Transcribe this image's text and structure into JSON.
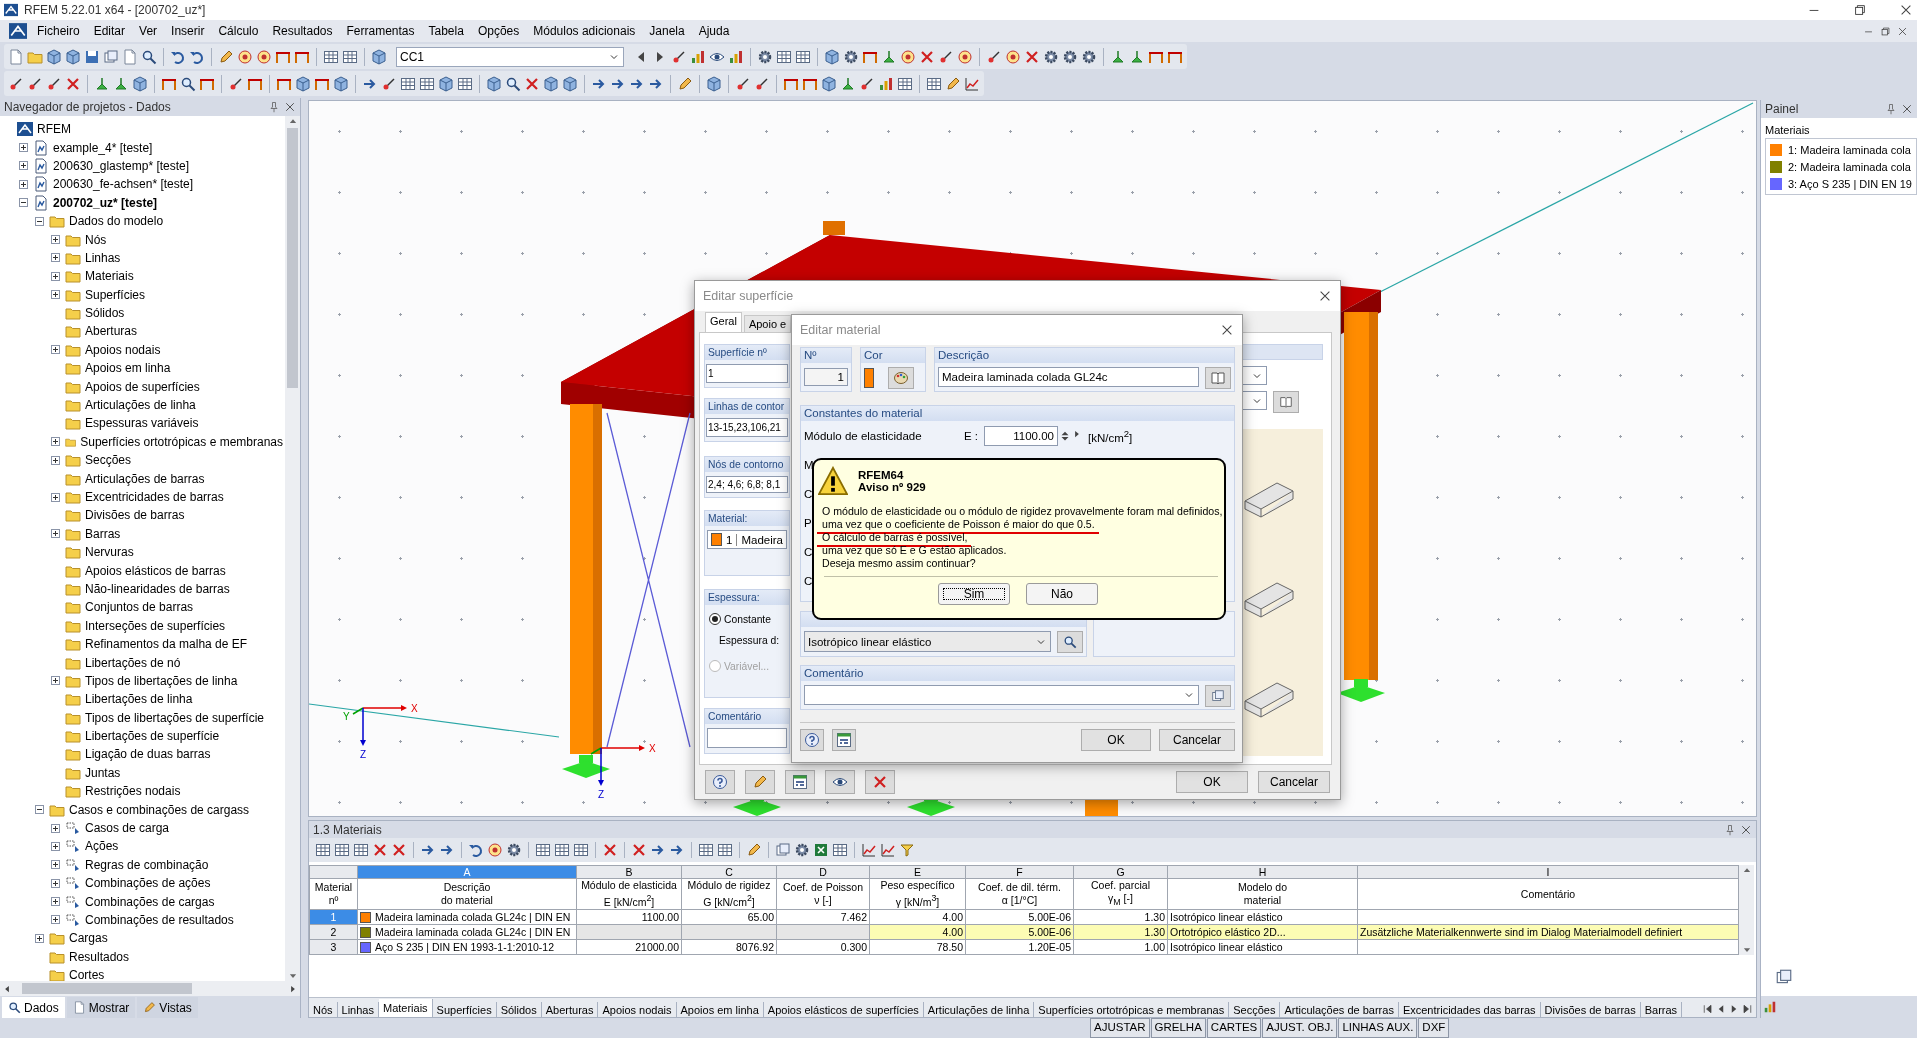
{
  "window": {
    "title": "RFEM 5.22.01 x64 - [200702_uz*]"
  },
  "menu": [
    "Ficheiro",
    "Editar",
    "Ver",
    "Inserir",
    "Cálculo",
    "Resultados",
    "Ferramentas",
    "Tabela",
    "Opções",
    "Módulos adicionais",
    "Janela",
    "Ajuda"
  ],
  "toolbar": {
    "load_case": "CC1"
  },
  "navigator": {
    "title": "Navegador de projetos - Dados",
    "tree": [
      {
        "label": "RFEM",
        "kind": "app",
        "children": [
          {
            "label": "example_4* [teste]",
            "kind": "project",
            "expanded": false,
            "active": false
          },
          {
            "label": "200630_glastemp* [teste]",
            "kind": "project",
            "expanded": false,
            "active": false
          },
          {
            "label": "200630_fe-achsen* [teste]",
            "kind": "project",
            "expanded": false,
            "active": false
          },
          {
            "label": "200702_uz* [teste]",
            "kind": "project",
            "expanded": true,
            "active": true,
            "children": [
              {
                "label": "Dados do modelo",
                "kind": "folder",
                "expanded": true,
                "children": [
                  {
                    "label": "Nós",
                    "kind": "folder",
                    "expanded": false
                  },
                  {
                    "label": "Linhas",
                    "kind": "folder",
                    "expanded": false
                  },
                  {
                    "label": "Materiais",
                    "kind": "folder",
                    "expanded": false
                  },
                  {
                    "label": "Superfícies",
                    "kind": "folder",
                    "expanded": false
                  },
                  {
                    "label": "Sólidos",
                    "kind": "folder"
                  },
                  {
                    "label": "Aberturas",
                    "kind": "folder"
                  },
                  {
                    "label": "Apoios nodais",
                    "kind": "folder",
                    "expanded": false
                  },
                  {
                    "label": "Apoios em linha",
                    "kind": "folder"
                  },
                  {
                    "label": "Apoios de superfícies",
                    "kind": "folder"
                  },
                  {
                    "label": "Articulações de linha",
                    "kind": "folder"
                  },
                  {
                    "label": "Espessuras variáveis",
                    "kind": "folder"
                  },
                  {
                    "label": "Superfícies ortotrópicas e membranas",
                    "kind": "folder",
                    "expanded": false
                  },
                  {
                    "label": "Secções",
                    "kind": "folder",
                    "expanded": false
                  },
                  {
                    "label": "Articulações de barras",
                    "kind": "folder"
                  },
                  {
                    "label": "Excentricidades de barras",
                    "kind": "folder",
                    "expanded": false
                  },
                  {
                    "label": "Divisões de barras",
                    "kind": "folder"
                  },
                  {
                    "label": "Barras",
                    "kind": "folder",
                    "expanded": false
                  },
                  {
                    "label": "Nervuras",
                    "kind": "folder"
                  },
                  {
                    "label": "Apoios elásticos de barras",
                    "kind": "folder"
                  },
                  {
                    "label": "Não-linearidades de barras",
                    "kind": "folder"
                  },
                  {
                    "label": "Conjuntos de barras",
                    "kind": "folder"
                  },
                  {
                    "label": "Interseções de superfícies",
                    "kind": "folder"
                  },
                  {
                    "label": "Refinamentos da malha de EF",
                    "kind": "folder"
                  },
                  {
                    "label": "Libertações de nó",
                    "kind": "folder"
                  },
                  {
                    "label": "Tipos de libertações de linha",
                    "kind": "folder",
                    "expanded": false
                  },
                  {
                    "label": "Libertações de linha",
                    "kind": "folder"
                  },
                  {
                    "label": "Tipos de libertações de superfície",
                    "kind": "folder"
                  },
                  {
                    "label": "Libertações de superfície",
                    "kind": "folder"
                  },
                  {
                    "label": "Ligação de duas barras",
                    "kind": "folder"
                  },
                  {
                    "label": "Juntas",
                    "kind": "folder"
                  },
                  {
                    "label": "Restrições nodais",
                    "kind": "folder"
                  }
                ]
              },
              {
                "label": "Casos e combinações de cargass",
                "kind": "folder",
                "expanded": true,
                "children": [
                  {
                    "label": "Casos de carga",
                    "kind": "case",
                    "expanded": false
                  },
                  {
                    "label": "Ações",
                    "kind": "case",
                    "expanded": false
                  },
                  {
                    "label": "Regras de combinação",
                    "kind": "case",
                    "expanded": false
                  },
                  {
                    "label": "Combinações de ações",
                    "kind": "case",
                    "expanded": false
                  },
                  {
                    "label": "Combinações de cargas",
                    "kind": "case",
                    "expanded": false
                  },
                  {
                    "label": "Combinações de resultados",
                    "kind": "case",
                    "expanded": false
                  }
                ]
              },
              {
                "label": "Cargas",
                "kind": "folder",
                "expanded": false
              },
              {
                "label": "Resultados",
                "kind": "folder"
              },
              {
                "label": "Cortes",
                "kind": "folder"
              }
            ]
          }
        ]
      }
    ],
    "tabs": [
      {
        "label": "Dados",
        "selected": true
      },
      {
        "label": "Mostrar",
        "selected": false
      },
      {
        "label": "Vistas",
        "selected": false
      }
    ]
  },
  "view": {
    "axes": [
      {
        "x": "X",
        "y": "Y",
        "z": "Z"
      },
      {
        "x": "X",
        "z": "Z"
      }
    ]
  },
  "surface_dialog": {
    "title": "Editar superfície",
    "tabs": [
      {
        "label": "Geral",
        "selected": true
      },
      {
        "label": "Apoio e",
        "selected": false
      }
    ],
    "surface_no": {
      "label": "Superfície nº",
      "value": "1"
    },
    "boundary_lines": {
      "label": "Linhas de contor",
      "value": "13-15,23,106,21"
    },
    "boundary_nodes": {
      "label": "Nós de contorno",
      "value": "2,4; 4,6; 6,8; 8,1"
    },
    "material": {
      "label": "Material:",
      "color": "#ff8000",
      "number": "1",
      "name": "Madeira"
    },
    "thickness": {
      "label": "Espessura:",
      "field_label": "Espessura d:",
      "options": [
        {
          "label": "Constante",
          "selected": true,
          "disabled": false
        },
        {
          "label": "Variável...",
          "selected": false,
          "disabled": true
        }
      ]
    },
    "comment": {
      "label": "Comentário"
    },
    "buttons": [
      "OK",
      "Cancelar"
    ]
  },
  "material_dialog": {
    "title": "Editar material",
    "number": {
      "label": "Nº",
      "value": "1"
    },
    "swatch": {
      "label": "Cor",
      "color": "#ff8000"
    },
    "description": {
      "label": "Descrição",
      "value": "Madeira laminada colada GL24c"
    },
    "constants": {
      "label": "Constantes do material",
      "elasticity": {
        "label": "Módulo de elasticidade",
        "symbol": "E :",
        "value": "1100.00",
        "unit": "[kN/cm$^{2}$]"
      },
      "covered_labels": [
        "M",
        "C",
        "P",
        "C",
        "C"
      ]
    },
    "material_model": {
      "value": "Isotrópico linear elástico"
    },
    "comment": {
      "label": "Comentário"
    },
    "buttons": [
      "OK",
      "Cancelar"
    ]
  },
  "warning": {
    "app": "RFEM64",
    "title": "Aviso nº 929",
    "lines": [
      {
        "text": "O módulo de elasticidade ou o módulo de rigidez provavelmente foram mal definidos,",
        "underlined": false
      },
      {
        "text": "uma vez que o coeficiente de Poisson é maior do que 0.5.",
        "underlined": true
      },
      {
        "text": "O cálculo de barras é possível,",
        "underlined": true
      },
      {
        "text": "uma vez que só E e G estão aplicados.",
        "underlined": false
      },
      {
        "text": "Deseja mesmo assim continuar?",
        "underlined": false
      }
    ],
    "buttons": [
      {
        "label": "Sim",
        "selected": true
      },
      {
        "label": "Não",
        "selected": false
      }
    ]
  },
  "panel": {
    "title": "Painel",
    "heading": "Materiais",
    "items": [
      {
        "label": "1: Madeira laminada cola",
        "color": "#ff8000"
      },
      {
        "label": "2: Madeira laminada cola",
        "color": "#808000"
      },
      {
        "label": "3: Aço S 235 | DIN EN 19",
        "color": "#6666ff"
      }
    ]
  },
  "table": {
    "title": "1.3 Materiais",
    "columns": [
      {
        "header": [
          "Material",
          "nº"
        ]
      },
      {
        "letter": "A",
        "selected": true,
        "header": [
          "Descrição",
          "do material"
        ]
      },
      {
        "letter": "B",
        "selected": false,
        "header": [
          "Módulo de elasticida",
          "E [kN/cm$^{2}$]"
        ]
      },
      {
        "letter": "C",
        "selected": false,
        "header": [
          "Módulo de rigidez",
          "G [kN/cm$^{2}$]"
        ]
      },
      {
        "letter": "D",
        "selected": false,
        "header": [
          "Coef. de Poisson",
          "ν [-]"
        ]
      },
      {
        "letter": "E",
        "selected": false,
        "header": [
          "Peso específico",
          "γ [kN/m$^{3}$]"
        ]
      },
      {
        "letter": "F",
        "selected": false,
        "header": [
          "Coef. de dil. térm.",
          "α [1/°C]"
        ]
      },
      {
        "letter": "G",
        "selected": false,
        "header": [
          "Coef. parcial",
          "γ$_{M}$ [-]"
        ]
      },
      {
        "letter": "H",
        "selected": false,
        "header": [
          "Modelo do",
          "material"
        ]
      },
      {
        "letter": "I",
        "selected": false,
        "header": [
          "Comentário"
        ]
      }
    ],
    "rows": [
      {
        "selected": true,
        "highlighted": false,
        "color": "#ff8000",
        "cells": [
          "1",
          "Madeira laminada colada GL24c | DIN EN",
          "1100.00",
          "65.00",
          "7.462",
          "4.00",
          "5.00E-06",
          "1.30",
          "Isotrópico linear elástico",
          ""
        ]
      },
      {
        "selected": false,
        "highlighted": true,
        "color": "#808000",
        "cells": [
          "2",
          "Madeira laminada colada GL24c | DIN EN",
          "",
          "",
          "",
          "4.00",
          "5.00E-06",
          "1.30",
          "Ortotrópico elástico 2D...",
          "Zusätzliche Materialkennwerte sind im Dialog Materialmodell definiert"
        ]
      },
      {
        "selected": false,
        "highlighted": false,
        "color": "#6666ff",
        "cells": [
          "3",
          "Aço S 235 | DIN EN 1993-1-1:2010-12",
          "21000.00",
          "8076.92",
          "0.300",
          "78.50",
          "1.20E-05",
          "1.00",
          "Isotrópico linear elástico",
          ""
        ]
      }
    ],
    "tabs": [
      {
        "label": "Nós",
        "selected": false
      },
      {
        "label": "Linhas",
        "selected": false
      },
      {
        "label": "Materiais",
        "selected": true
      },
      {
        "label": "Superfícies",
        "selected": false
      },
      {
        "label": "Sólidos",
        "selected": false
      },
      {
        "label": "Aberturas",
        "selected": false
      },
      {
        "label": "Apoios nodais",
        "selected": false
      },
      {
        "label": "Apoios em linha",
        "selected": false
      },
      {
        "label": "Apoios elásticos de superfícies",
        "selected": false
      },
      {
        "label": "Articulações de linha",
        "selected": false
      },
      {
        "label": "Superfícies ortotrópicas e membranas",
        "selected": false
      },
      {
        "label": "Secções",
        "selected": false
      },
      {
        "label": "Articulações de barras",
        "selected": false
      },
      {
        "label": "Excentricidades das barras",
        "selected": false
      },
      {
        "label": "Divisões de barras",
        "selected": false
      },
      {
        "label": "Barras",
        "selected": false
      }
    ]
  },
  "status_bar": [
    "AJUSTAR",
    "GRELHA",
    "CARTES",
    "AJUST. OBJ.",
    "LINHAS AUX.",
    "DXF"
  ]
}
